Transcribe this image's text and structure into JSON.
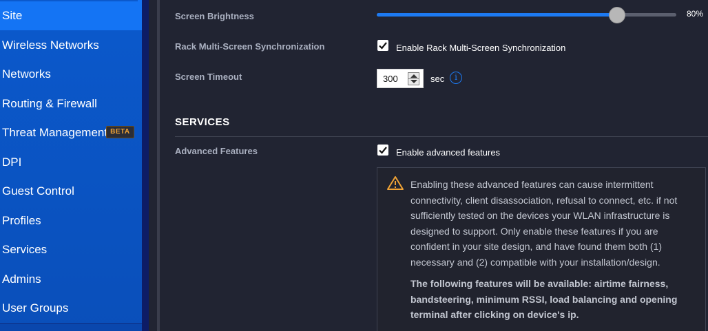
{
  "sidebar": {
    "items": [
      {
        "label": "Site",
        "active": true
      },
      {
        "label": "Wireless Networks"
      },
      {
        "label": "Networks"
      },
      {
        "label": "Routing & Firewall"
      },
      {
        "label": "Threat Management",
        "badge": "BETA"
      },
      {
        "label": "DPI"
      },
      {
        "label": "Guest Control"
      },
      {
        "label": "Profiles"
      },
      {
        "label": "Services"
      },
      {
        "label": "Admins"
      },
      {
        "label": "User Groups"
      }
    ]
  },
  "settings": {
    "brightness": {
      "label": "Screen Brightness",
      "value": 80,
      "value_text": "80%"
    },
    "rack_sync": {
      "label": "Rack Multi-Screen Synchronization",
      "checkbox_label": "Enable Rack Multi-Screen Synchronization",
      "checked": true
    },
    "timeout": {
      "label": "Screen Timeout",
      "value": "300",
      "unit": "sec"
    }
  },
  "services": {
    "title": "SERVICES",
    "advanced": {
      "label": "Advanced Features",
      "checkbox_label": "Enable advanced features",
      "checked": true,
      "warning_text": "Enabling these advanced features can cause intermittent connectivity, client disassociation, refusal to connect, etc. if not sufficiently tested on the devices your WLAN infrastructure is designed to support. Only enable these features if you are confident in your site design, and have found them both (1) necessary and (2) compatible with your installation/design.",
      "features_text": "The following features will be available: airtime fairness, bandsteering, minimum RSSI, load balancing and opening terminal after clicking on device's ip."
    }
  },
  "colors": {
    "accent": "#1d7af2",
    "sidebar": "#0b59cc",
    "background": "#212432",
    "warning": "#f0a336"
  }
}
